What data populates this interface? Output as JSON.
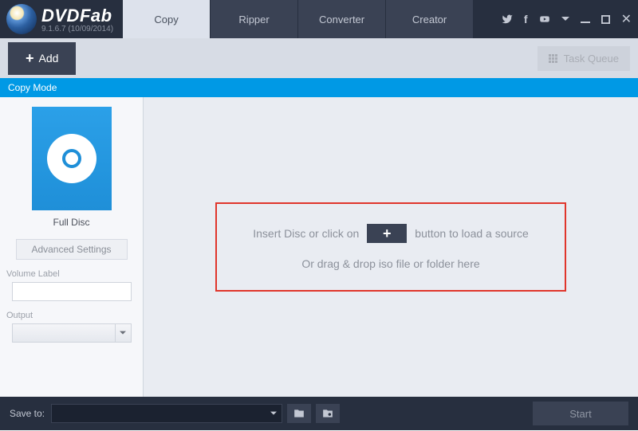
{
  "brand": "DVDFab",
  "version": "9.1.6.7 (10/09/2014)",
  "tabs": [
    "Copy",
    "Ripper",
    "Converter",
    "Creator"
  ],
  "activeTab": 0,
  "toolbar": {
    "add": "Add",
    "taskQueue": "Task Queue"
  },
  "modeBar": "Copy Mode",
  "sidebar": {
    "thumbLabel": "Full Disc",
    "advanced": "Advanced Settings",
    "volumeLabelText": "Volume Label",
    "volumeValue": "",
    "outputText": "Output",
    "outputValue": ""
  },
  "dropzone": {
    "pre": "Insert Disc or click on",
    "post": "button to load a source",
    "line2": "Or drag & drop iso file or folder here"
  },
  "footer": {
    "saveTo": "Save to:",
    "saveValue": "",
    "start": "Start"
  }
}
